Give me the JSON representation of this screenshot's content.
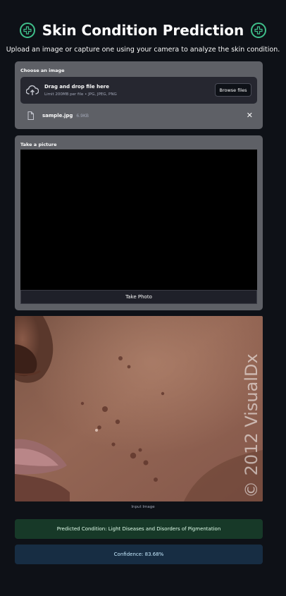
{
  "header": {
    "title": "Skin Condition Prediction",
    "subtitle": "Upload an image or capture one using your camera to analyze the skin condition.",
    "accent": "#3fbf8a"
  },
  "uploader": {
    "label": "Choose an image",
    "drop_text": "Drag and drop file here",
    "limit_text": "Limit 200MB per file • JPG, JPEG, PNG",
    "browse_label": "Browse files",
    "file_name": "sample.jpg",
    "file_size": "6.9KB"
  },
  "camera": {
    "label": "Take a picture",
    "button_label": "Take Photo"
  },
  "image": {
    "watermark": "© 2012 VisualDx",
    "caption": "Input Image"
  },
  "result": {
    "prediction": "Predicted Condition: Light Diseases and Disorders of Pigmentation",
    "confidence": "Confidence: 83.68%"
  },
  "colors": {
    "background": "#0e1117",
    "card": "#5e6066",
    "success_bg": "#173928",
    "info_bg": "#172d43"
  }
}
